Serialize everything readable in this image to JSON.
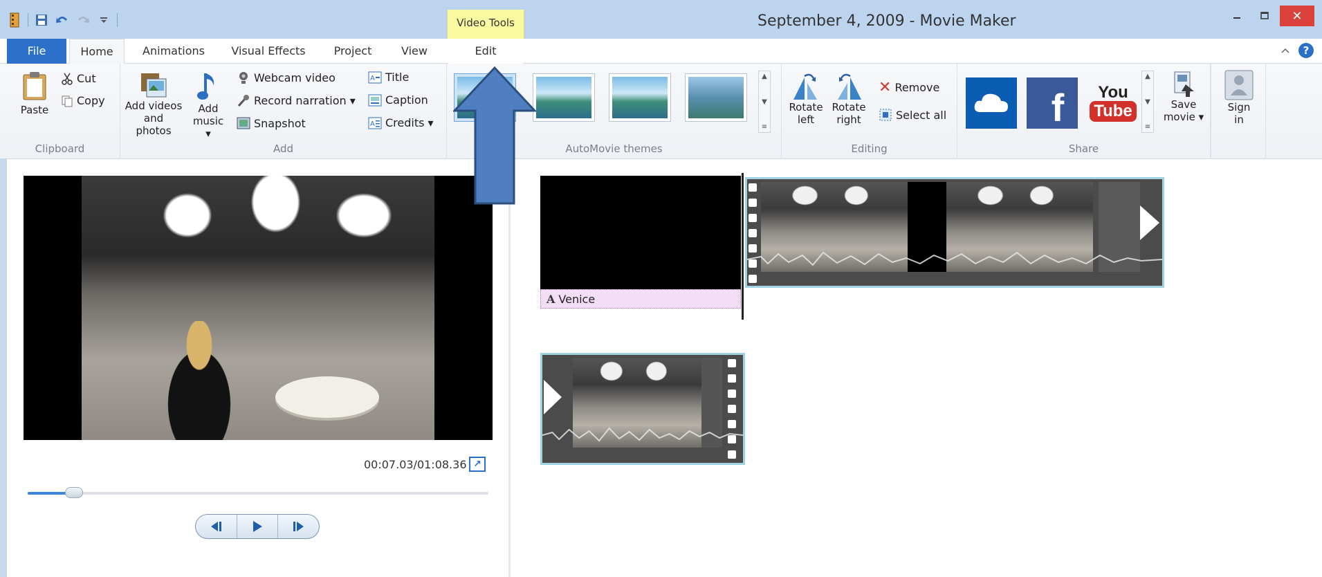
{
  "window": {
    "title": "September 4, 2009 - Movie Maker",
    "contextual_group": "Video Tools",
    "close_symbol": "✕"
  },
  "tabs": [
    {
      "label": "File"
    },
    {
      "label": "Home"
    },
    {
      "label": "Animations"
    },
    {
      "label": "Visual Effects"
    },
    {
      "label": "Project"
    },
    {
      "label": "View"
    },
    {
      "label": "Edit"
    }
  ],
  "ribbon": {
    "clipboard": {
      "label": "Clipboard",
      "paste": "Paste",
      "cut": "Cut",
      "copy": "Copy"
    },
    "add": {
      "label": "Add",
      "add_videos_line1": "Add videos",
      "add_videos_line2": "and photos",
      "add_music_line1": "Add",
      "add_music_line2": "music ▾",
      "webcam": "Webcam video",
      "record": "Record narration ▾",
      "snapshot": "Snapshot",
      "title": "Title",
      "caption": "Caption",
      "credits": "Credits ▾"
    },
    "themes": {
      "label": "AutoMovie themes"
    },
    "editing": {
      "label": "Editing",
      "rotate_left_line1": "Rotate",
      "rotate_left_line2": "left",
      "rotate_right_line1": "Rotate",
      "rotate_right_line2": "right",
      "remove": "Remove",
      "select_all": "Select all"
    },
    "share": {
      "label": "Share",
      "youtube_line1": "You",
      "youtube_line2": "Tube",
      "facebook_letter": "f",
      "save_line1": "Save",
      "save_line2": "movie ▾",
      "sign_line1": "Sign",
      "sign_line2": "in"
    }
  },
  "preview": {
    "timecode": "00:07.03/01:08.36",
    "progress_fraction": 0.1
  },
  "storyboard": {
    "caption_text": "Venice"
  },
  "colors": {
    "accent": "#2b71c9",
    "clip_border": "#9fd2e3",
    "caption_bg": "#f3ddf7",
    "annotation_arrow": "#4f7fc0"
  }
}
